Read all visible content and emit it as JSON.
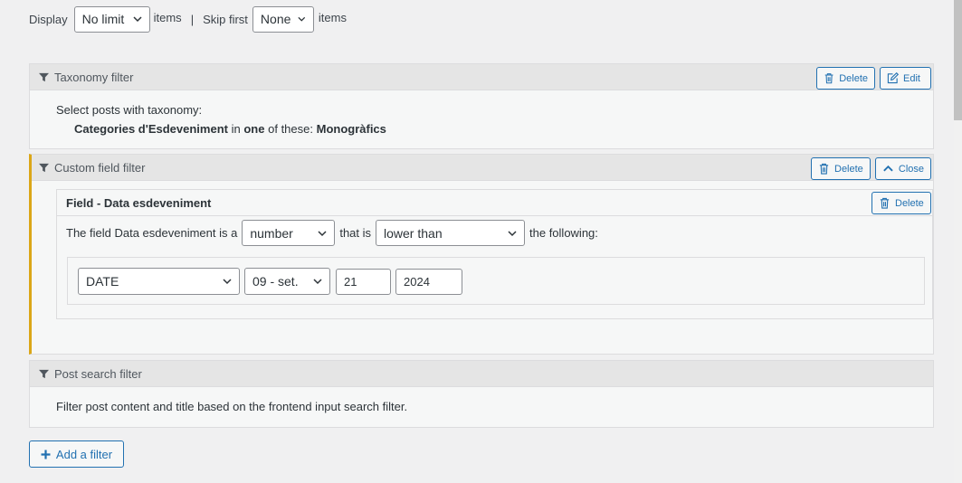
{
  "limit": {
    "display_label": "Display",
    "display_value": "No limit",
    "items_label": "items",
    "separator": "|",
    "skip_label": "Skip first",
    "skip_value": "None",
    "items_label2": "items"
  },
  "taxonomy_filter": {
    "title": "Taxonomy filter",
    "delete_label": "Delete",
    "edit_label": "Edit",
    "line1": "Select posts with taxonomy:",
    "taxonomy": "Categories d'Esdeveniment",
    "in_word": "in",
    "one_word": "one",
    "of_these": "of these:",
    "term": "Monogràfics"
  },
  "custom_field_filter": {
    "title": "Custom field filter",
    "delete_label": "Delete",
    "close_label": "Close",
    "field": {
      "title": "Field - Data esdeveniment",
      "delete_label": "Delete",
      "prefix": "The field Data esdeveniment is a",
      "type_value": "number",
      "that_is": "that is",
      "comparison_value": "lower than",
      "suffix": "the following:",
      "date_kind": "DATE",
      "month": "09 - set.",
      "day": "21",
      "year": "2024"
    }
  },
  "post_search_filter": {
    "title": "Post search filter",
    "description": "Filter post content and title based on the frontend input search filter."
  },
  "add_filter_label": "Add a filter",
  "colors": {
    "accent": "#2271b1",
    "active_border": "#dba617",
    "panel_head": "#e5e5e5"
  }
}
